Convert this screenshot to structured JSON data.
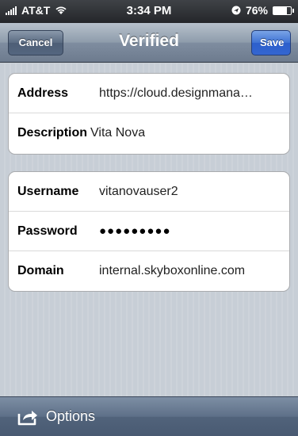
{
  "status_bar": {
    "carrier": "AT&T",
    "time": "3:34 PM",
    "battery": "76%",
    "battery_level": 0.76
  },
  "nav": {
    "cancel_label": "Cancel",
    "title": "Verified",
    "save_label": "Save"
  },
  "server_group": {
    "rows": [
      {
        "label": "Address",
        "value": "https://cloud.designmana…"
      },
      {
        "label": "Description",
        "value": "Vita Nova"
      }
    ]
  },
  "account_group": {
    "rows": [
      {
        "label": "Username",
        "value": "vitanovauser2"
      },
      {
        "label": "Password",
        "value": "●●●●●●●●●"
      },
      {
        "label": "Domain",
        "value": "internal.skyboxonline.com"
      }
    ]
  },
  "toolbar": {
    "options_label": "Options",
    "options_icon": "share-icon"
  },
  "colors": {
    "save_button": "#3466d1",
    "value_text": "#314d7a"
  }
}
